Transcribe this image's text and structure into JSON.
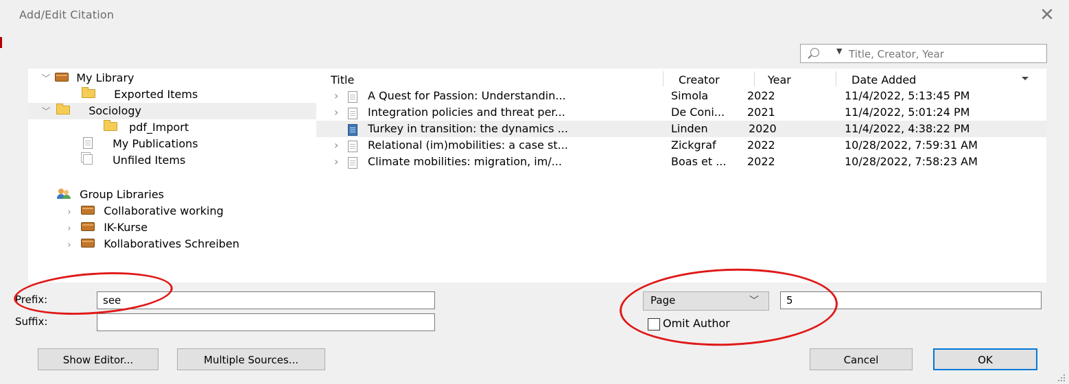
{
  "window": {
    "title": "Add/Edit Citation"
  },
  "search": {
    "placeholder": "Title, Creator, Year"
  },
  "tree": {
    "my_library": "My Library",
    "exported_items": "Exported Items",
    "sociology": "Sociology",
    "pdf_import": "pdf_Import",
    "my_publications": "My Publications",
    "unfiled_items": "Unfiled Items",
    "group_libraries": "Group Libraries",
    "groups": [
      "Collaborative working",
      "IK-Kurse",
      "Kollaboratives Schreiben"
    ]
  },
  "items_table": {
    "columns": {
      "title": "Title",
      "creator": "Creator",
      "year": "Year",
      "date_added": "Date Added"
    },
    "rows": [
      {
        "title": "A Quest for Passion: Understandin...",
        "creator": "Simola",
        "year": "2022",
        "date_added": "11/4/2022, 5:13:45 PM"
      },
      {
        "title": "Integration policies and threat per...",
        "creator": "De Coni...",
        "year": "2021",
        "date_added": "11/4/2022, 5:01:24 PM"
      },
      {
        "title": "Turkey in transition: the dynamics ...",
        "creator": "Linden",
        "year": "2020",
        "date_added": "11/4/2022, 4:38:22 PM"
      },
      {
        "title": "Relational (im)mobilities: a case st...",
        "creator": "Zickgraf",
        "year": "2022",
        "date_added": "10/28/2022, 7:59:31 AM"
      },
      {
        "title": "Climate mobilities: migration, im/...",
        "creator": "Boas et ...",
        "year": "2022",
        "date_added": "10/28/2022, 7:58:23 AM"
      }
    ]
  },
  "citation": {
    "prefix_label": "Prefix:",
    "prefix_value": "see",
    "suffix_label": "Suffix:",
    "suffix_value": "",
    "locator_type": "Page",
    "locator_value": "5",
    "omit_author_label": "Omit Author",
    "omit_author_checked": false
  },
  "buttons": {
    "show_editor": "Show Editor...",
    "multiple_sources": "Multiple Sources...",
    "cancel": "Cancel",
    "ok": "OK"
  },
  "colors": {
    "highlight_ellipse": "#e01818",
    "default_button_border": "#0078d7",
    "library_folder": "#c1762a",
    "collection_folder": "#f5cd55"
  }
}
